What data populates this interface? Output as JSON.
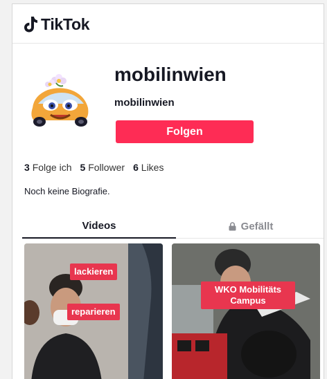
{
  "app": {
    "name": "TikTok"
  },
  "profile": {
    "username": "mobilinwien",
    "nickname": "mobilinwien",
    "follow_label": "Folgen",
    "stats": {
      "following_count": "3",
      "following_label": "Folge ich",
      "followers_count": "5",
      "followers_label": "Follower",
      "likes_count": "6",
      "likes_label": "Likes"
    },
    "bio": "Noch keine Biografie."
  },
  "tabs": [
    {
      "label": "Videos"
    },
    {
      "label": "Gefällt"
    }
  ],
  "videos": [
    {
      "tags": [
        "lackieren",
        "reparieren"
      ]
    },
    {
      "tags": [
        "WKO Mobilitäts Campus"
      ]
    }
  ],
  "colors": {
    "accent": "#fe2c55",
    "tag": "#e8364f",
    "text": "#161823",
    "muted": "#8a8b91"
  }
}
